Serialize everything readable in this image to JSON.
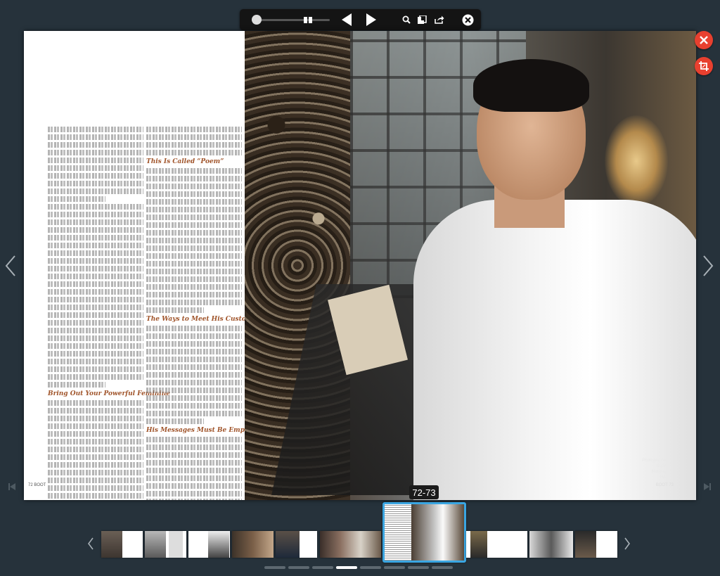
{
  "toolbar": {
    "zoom_level": 0.05,
    "icons": [
      "zoom-slider",
      "double-page-icon",
      "previous-page-icon",
      "next-page-icon",
      "search-icon",
      "bookmarks-icon",
      "share-icon",
      "close-viewer-icon"
    ]
  },
  "spread": {
    "page_indicator": "72-73",
    "left_page": {
      "headings": [
        "This Is Called “Poem”",
        "The Ways to Meet His Customers",
        "Bring Out Your Powerful Feminine",
        "His Messages Must Be Emphasized"
      ],
      "footer": "72 BOOT"
    },
    "right_page": {
      "credits": [
        "Photographer: ... ",
        "Stylist: ... ",
        "Make-up: ... ",
        "Hair: ... "
      ],
      "footer": "BOOT 73"
    }
  },
  "floating_buttons": [
    "close-icon",
    "crop-icon"
  ],
  "navigation": {
    "left_arrow": "‹",
    "right_arrow": "›",
    "first_page": "⏮",
    "last_page": "⏭"
  },
  "thumbnails": {
    "left_arrow": "‹",
    "right_arrow": "›",
    "selected_index": 5,
    "count": 11
  },
  "pager_dots": {
    "count": 8,
    "active_index": 3
  },
  "colors": {
    "background": "#26323b",
    "accent_red": "#e8402f",
    "selection_blue": "#3aa6e2",
    "heading_brown": "#a0542a"
  }
}
